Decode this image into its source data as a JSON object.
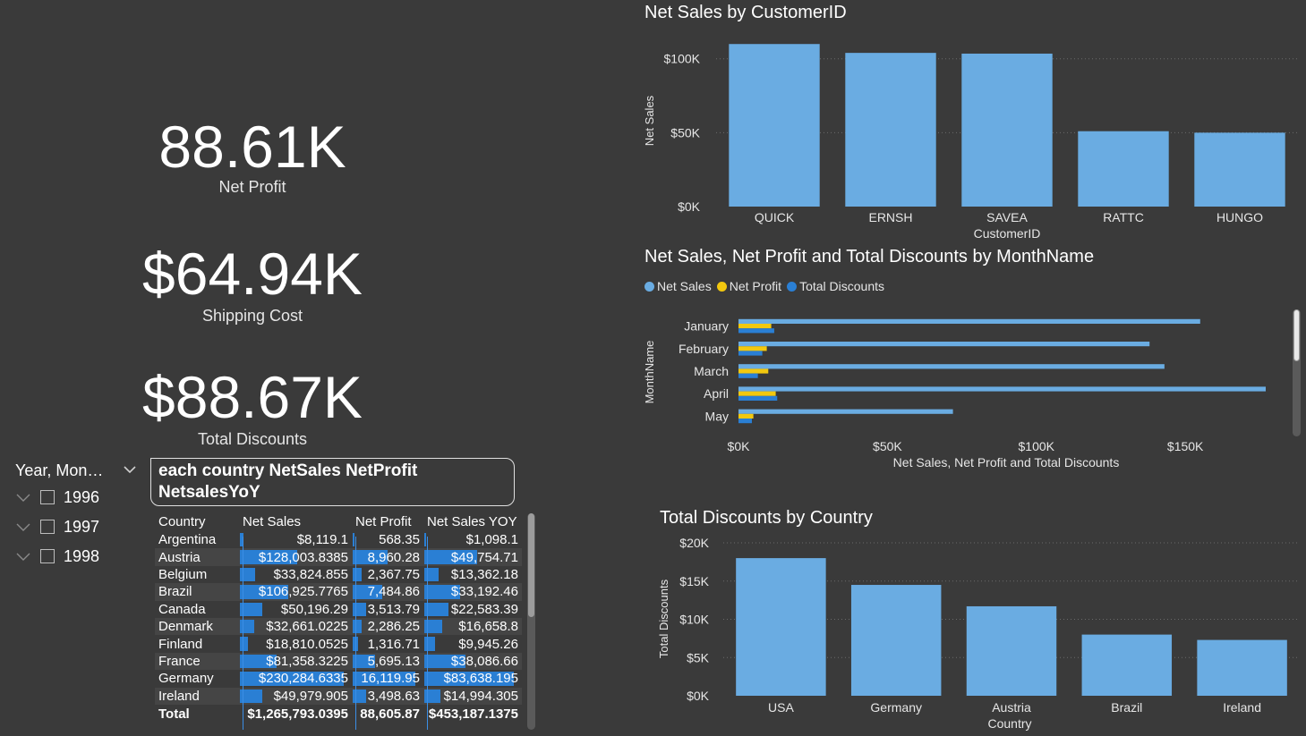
{
  "cards": [
    {
      "value": "88.61K",
      "label": "Net Profit"
    },
    {
      "value": "$64.94K",
      "label": "Shipping Cost"
    },
    {
      "value": "$88.67K",
      "label": "Total Discounts"
    }
  ],
  "slicer": {
    "title": "Year, Mon…",
    "items": [
      {
        "label": "1996"
      },
      {
        "label": "1997"
      },
      {
        "label": "1998"
      }
    ]
  },
  "table": {
    "title": "each country NetSales NetProfit NetsalesYoY",
    "columns": [
      "Country",
      "Net Sales",
      "Net Profit",
      "Net Sales YOY"
    ],
    "rows": [
      {
        "country": "Argentina",
        "net_sales": "$8,119.1",
        "net_profit": "568.35",
        "yoy": "$1,098.1",
        "ns": 8119.1,
        "np": 568.35,
        "y": 1098.1
      },
      {
        "country": "Austria",
        "net_sales": "$128,003.8385",
        "net_profit": "8,960.28",
        "yoy": "$49,754.71",
        "ns": 128003.84,
        "np": 8960.28,
        "y": 49754.71
      },
      {
        "country": "Belgium",
        "net_sales": "$33,824.855",
        "net_profit": "2,367.75",
        "yoy": "$13,362.18",
        "ns": 33824.86,
        "np": 2367.75,
        "y": 13362.18
      },
      {
        "country": "Brazil",
        "net_sales": "$106,925.7765",
        "net_profit": "7,484.86",
        "yoy": "$33,192.46",
        "ns": 106925.78,
        "np": 7484.86,
        "y": 33192.46
      },
      {
        "country": "Canada",
        "net_sales": "$50,196.29",
        "net_profit": "3,513.79",
        "yoy": "$22,583.39",
        "ns": 50196.29,
        "np": 3513.79,
        "y": 22583.39
      },
      {
        "country": "Denmark",
        "net_sales": "$32,661.0225",
        "net_profit": "2,286.25",
        "yoy": "$16,658.8",
        "ns": 32661.02,
        "np": 2286.25,
        "y": 16658.8
      },
      {
        "country": "Finland",
        "net_sales": "$18,810.0525",
        "net_profit": "1,316.71",
        "yoy": "$9,945.26",
        "ns": 18810.05,
        "np": 1316.71,
        "y": 9945.26
      },
      {
        "country": "France",
        "net_sales": "$81,358.3225",
        "net_profit": "5,695.13",
        "yoy": "$38,086.66",
        "ns": 81358.32,
        "np": 5695.13,
        "y": 38086.66
      },
      {
        "country": "Germany",
        "net_sales": "$230,284.6335",
        "net_profit": "16,119.95",
        "yoy": "$83,638.195",
        "ns": 230284.63,
        "np": 16119.95,
        "y": 83638.2
      },
      {
        "country": "Ireland",
        "net_sales": "$49,979.905",
        "net_profit": "3,498.63",
        "yoy": "$14,994.305",
        "ns": 49979.91,
        "np": 3498.63,
        "y": 14994.31
      }
    ],
    "total": {
      "country": "Total",
      "net_sales": "$1,265,793.0395",
      "net_profit": "88,605.87",
      "yoy": "$453,187.1375"
    }
  },
  "colors": {
    "bar_blue": "#6aace2",
    "series_net_sales": "#6aace2",
    "series_net_profit": "#f2c80f",
    "series_discounts": "#2a7fd4",
    "table_bar": "#2a7fd4"
  },
  "chart_data": [
    {
      "type": "bar",
      "title": "Net Sales by CustomerID",
      "xlabel": "CustomerID",
      "ylabel": "Net Sales",
      "categories": [
        "QUICK",
        "ERNSH",
        "SAVEA",
        "RATTC",
        "HUNGO"
      ],
      "values": [
        110000,
        104000,
        103500,
        51000,
        50000
      ],
      "yticks": [
        {
          "v": 0,
          "label": "$0K"
        },
        {
          "v": 50000,
          "label": "$50K"
        },
        {
          "v": 100000,
          "label": "$100K"
        }
      ],
      "ylim": [
        0,
        118000
      ],
      "grid": true
    },
    {
      "type": "bar",
      "orientation": "horizontal",
      "title": "Net Sales, Net Profit and Total Discounts by MonthName",
      "xlabel": "Net Sales, Net Profit and Total Discounts",
      "ylabel": "MonthName",
      "categories": [
        "January",
        "February",
        "March",
        "April",
        "May"
      ],
      "series": [
        {
          "name": "Net Sales",
          "values": [
            155000,
            138000,
            143000,
            177000,
            72000
          ]
        },
        {
          "name": "Net Profit",
          "values": [
            11000,
            9500,
            10000,
            12500,
            5000
          ]
        },
        {
          "name": "Total Discounts",
          "values": [
            12000,
            8000,
            6500,
            13000,
            4500
          ]
        }
      ],
      "xticks": [
        {
          "v": 0,
          "label": "$0K"
        },
        {
          "v": 50000,
          "label": "$50K"
        },
        {
          "v": 100000,
          "label": "$100K"
        },
        {
          "v": 150000,
          "label": "$150K"
        }
      ],
      "xlim": [
        0,
        177000
      ],
      "legend": "top-left"
    },
    {
      "type": "bar",
      "title": "Total Discounts by Country",
      "xlabel": "Country",
      "ylabel": "Total Discounts",
      "categories": [
        "USA",
        "Germany",
        "Austria",
        "Brazil",
        "Ireland"
      ],
      "values": [
        18000,
        14500,
        11700,
        8000,
        7300
      ],
      "yticks": [
        {
          "v": 0,
          "label": "$0K"
        },
        {
          "v": 5000,
          "label": "$5K"
        },
        {
          "v": 10000,
          "label": "$10K"
        },
        {
          "v": 15000,
          "label": "$15K"
        },
        {
          "v": 20000,
          "label": "$20K"
        }
      ],
      "ylim": [
        0,
        20000
      ],
      "grid": true
    }
  ]
}
